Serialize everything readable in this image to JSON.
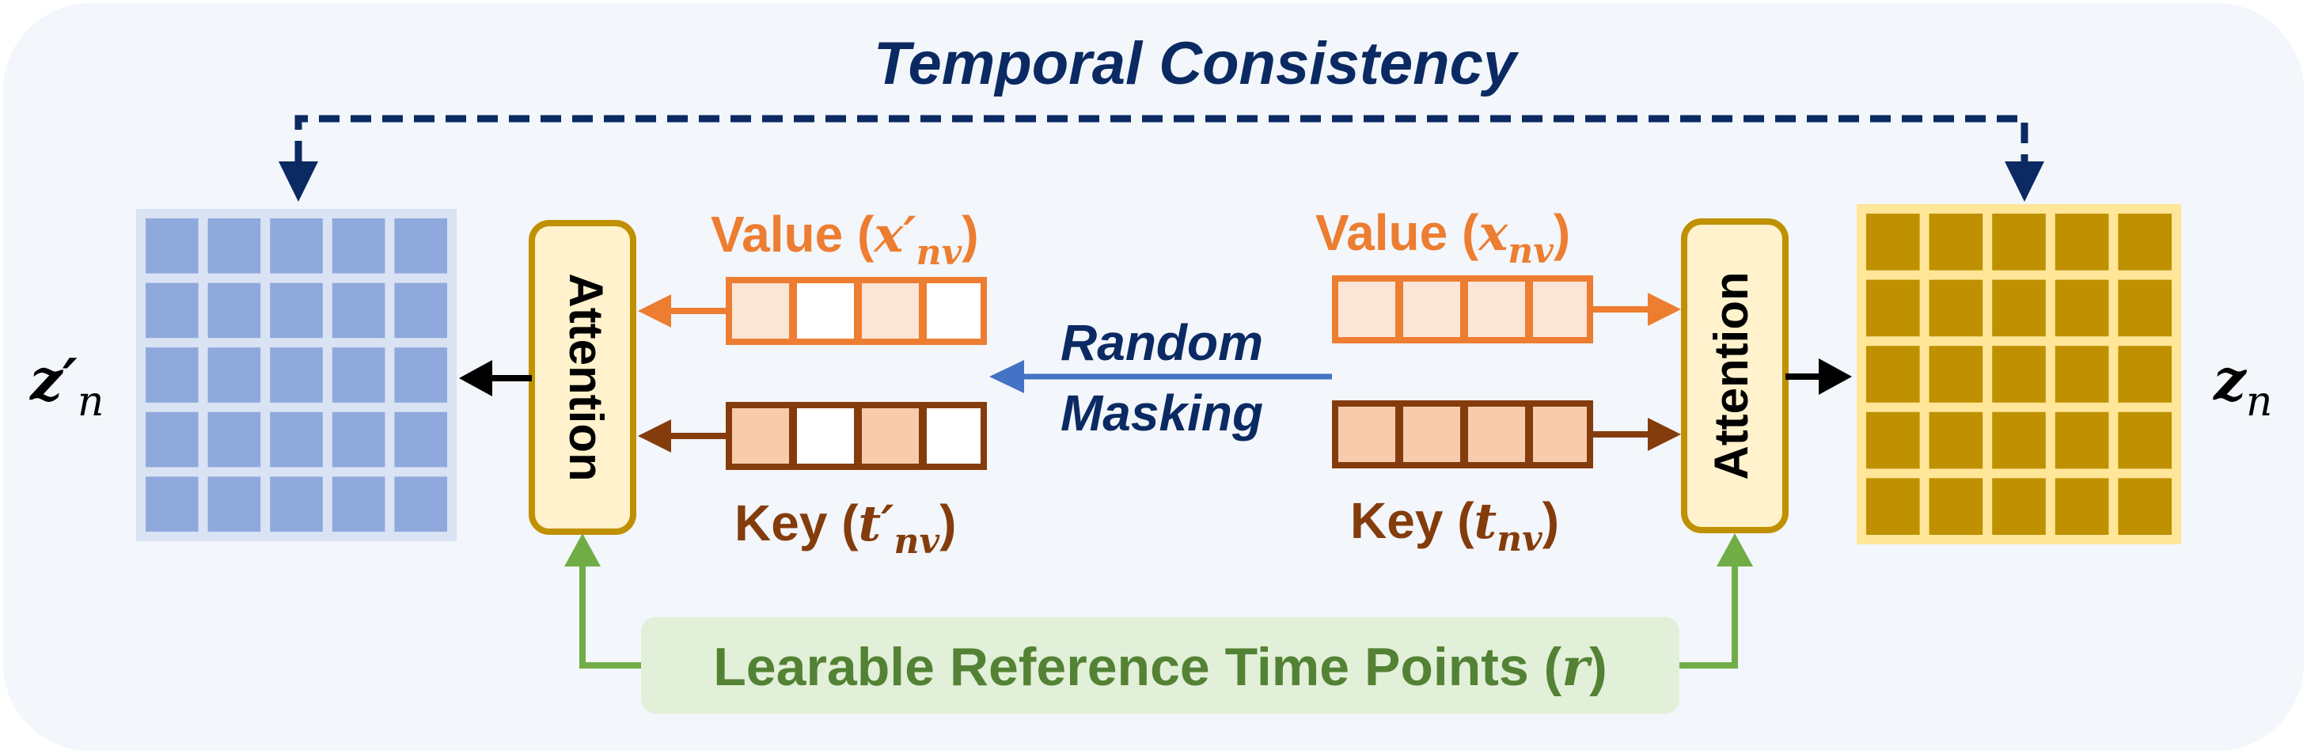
{
  "title": "Temporal Consistency",
  "left": {
    "output_var": "z′",
    "output_sub": "n",
    "attention_label": "Attention",
    "value_label": "Value (",
    "value_var": "x′",
    "value_sub": "nv",
    "key_label": "Key (",
    "key_var": "t′",
    "key_sub": "nv",
    "close_paren": ")"
  },
  "right": {
    "output_var": "z",
    "output_sub": "n",
    "attention_label": "Attention",
    "value_label": "Value (",
    "value_var": "x",
    "value_sub": "nv",
    "key_label": "Key (",
    "key_var": "t",
    "key_sub": "nv",
    "close_paren": ")"
  },
  "masking": {
    "line1": "Random",
    "line2": "Masking"
  },
  "reference": {
    "label": "Learable Reference Time Points (",
    "var": "r",
    "close": ")"
  },
  "colors": {
    "panel_bg": "#f3f6fb",
    "navy": "#0b2a63",
    "blue_cell": "#8fa9dc",
    "blue_grid_bg": "#dae3f3",
    "gold_cell": "#bf9000",
    "gold_grid_bg": "#ffe699",
    "attention_fill": "#fff2cc",
    "attention_border": "#bf9000",
    "orange": "#ed7d31",
    "orange_fill": "#fbe5d6",
    "brown": "#843c0c",
    "brown_fill": "#f8cbad",
    "masking_blue": "#4472c4",
    "green": "#70ad47",
    "green_fill": "#e2f0d9",
    "green_text": "#548235"
  }
}
